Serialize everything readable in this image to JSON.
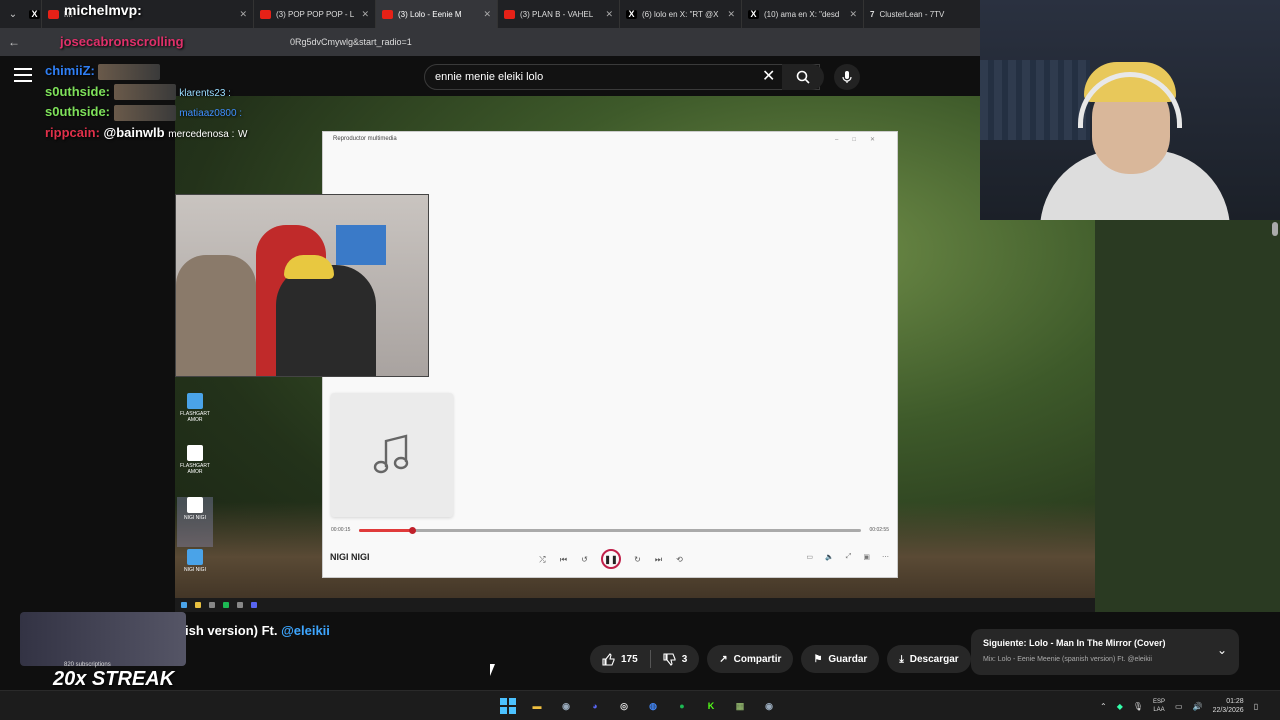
{
  "browser": {
    "tabs": [
      {
        "label": "",
        "type": "x"
      },
      {
        "label": "MI",
        "type": "yt",
        "active": false
      },
      {
        "label": "(3) POP POP POP - L",
        "type": "yt",
        "active": false
      },
      {
        "label": "(3) Lolo - Eenie M",
        "type": "yt",
        "active": true
      },
      {
        "label": "(3) PLAN B - VAHEL",
        "type": "yt",
        "active": false
      },
      {
        "label": "(6) lolo en X: \"RT @X",
        "type": "x",
        "active": false
      },
      {
        "label": "(10) ama en X: \"desd",
        "type": "x",
        "active": false
      },
      {
        "label": "ClusterLean - 7TV",
        "type": "7tv",
        "active": false
      }
    ],
    "url": "0Rg5dvCmywlg&start_radio=1"
  },
  "youtube": {
    "search_value": "ennie menie eleiki lolo",
    "title_fragment": "ish version) Ft.",
    "title_link": "@eleikii",
    "likes": "175",
    "dislikes": "3",
    "share_label": "Compartir",
    "save_label": "Guardar",
    "download_label": "Descargar",
    "next_title": "Siguiente: Lolo - Man In The Mirror (Cover)",
    "next_sub": "Mix: Lolo - Eenie Meenie (spanish version) Ft. @eleikii"
  },
  "stream_overlay": {
    "top_name": "michelmvp:",
    "second_name": "josecabronscrolling",
    "chat": [
      {
        "user": "chimiiZ:",
        "color": "#2f7ff5",
        "msg": ""
      },
      {
        "user": "s0uthside:",
        "color": "#7ee05a",
        "msg": ""
      },
      {
        "user": "s0uthside:",
        "color": "#7ee05a",
        "msg": ""
      },
      {
        "user": "rippcain:",
        "color": "#e0304a",
        "msg": "@bainwlb"
      }
    ],
    "small_chat": [
      {
        "user": "klarents23 :",
        "color": "#9adfff"
      },
      {
        "user": "matiaaz0800 :",
        "color": "#3f8fff"
      },
      {
        "user": "mercedenosa :",
        "msg": "W",
        "color": "#ffffff"
      }
    ],
    "streak": "20x STREAK",
    "streak_sub": "820 subscriptions"
  },
  "media_player": {
    "window_title": "Reproductor multimedia",
    "song": "NIGI NIGI",
    "time_current": "00:00:15",
    "time_total": "00:02:55",
    "progress": 0.1
  },
  "desktop_icons": [
    {
      "label": "FLASHGART AMOR"
    },
    {
      "label": "FLASHGART AMOR"
    },
    {
      "label": "NIGI NIGI"
    },
    {
      "label": "NIGI NIGI"
    }
  ],
  "taskbar": {
    "lang_top": "ESP",
    "lang_bottom": "LAA",
    "time": "01:28",
    "date": "22/3/2026"
  },
  "colors": {
    "accent_red": "#e03a3a",
    "link_blue": "#3ea6ff",
    "yt_bg": "#0f0f0f"
  }
}
